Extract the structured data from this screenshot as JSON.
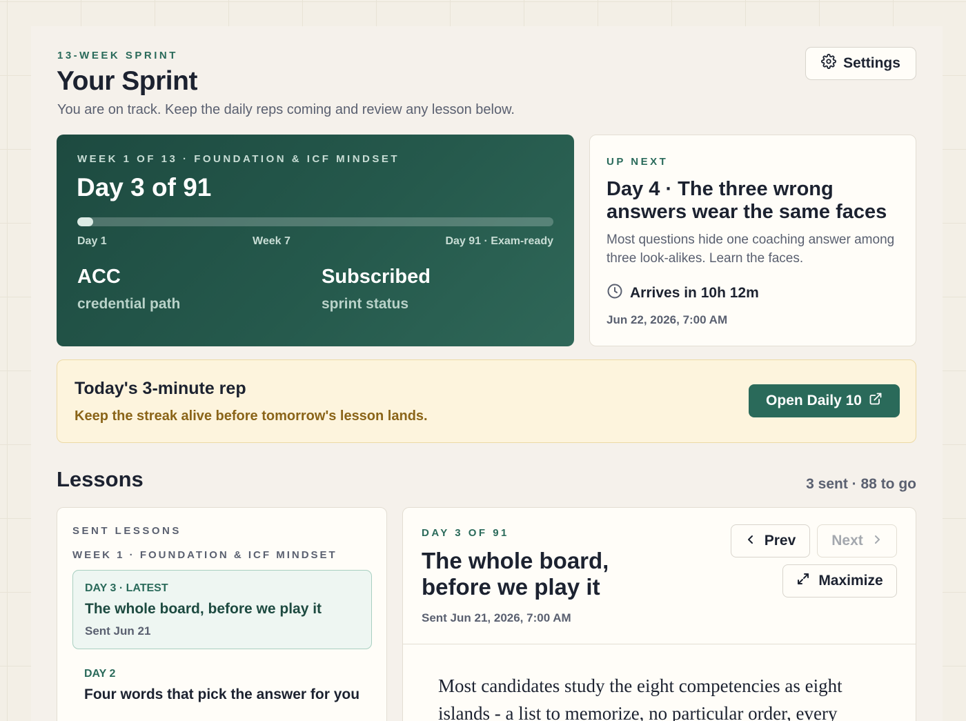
{
  "header": {
    "eyebrow": "13-WEEK SPRINT",
    "title": "Your Sprint",
    "subtitle": "You are on track. Keep the daily reps coming and review any lesson below.",
    "settings_label": "Settings"
  },
  "hero": {
    "eyebrow": "WEEK 1 OF 13 · FOUNDATION & ICF MINDSET",
    "day_title": "Day 3 of 91",
    "progress": 0.033,
    "milestones": [
      "Day 1",
      "Week 7",
      "Day 91 · Exam-ready"
    ],
    "stats": [
      {
        "value": "ACC",
        "label": "credential path"
      },
      {
        "value": "Subscribed",
        "label": "sprint status"
      }
    ]
  },
  "up_next": {
    "eyebrow": "UP NEXT",
    "title": "Day 4 · The three wrong answers wear the same faces",
    "description": "Most questions hide one coaching answer among three look-alikes. Learn the faces.",
    "arrives": "Arrives in 10h 12m",
    "date": "Jun 22, 2026, 7:00 AM"
  },
  "daily_rep": {
    "title": "Today's 3-minute rep",
    "subtitle": "Keep the streak alive before tomorrow's lesson lands.",
    "button_label": "Open Daily 10"
  },
  "lessons": {
    "title": "Lessons",
    "count": "3 sent · 88 to go",
    "list_eyebrow": "SENT LESSONS",
    "week_label": "WEEK 1 · FOUNDATION & ICF MINDSET",
    "items": [
      {
        "day": "DAY 3 · LATEST",
        "title": "The whole board, before we play it",
        "sent": "Sent Jun 21"
      },
      {
        "day": "DAY 2",
        "title": "Four words that pick the answer for you",
        "sent": ""
      }
    ]
  },
  "reader": {
    "eyebrow": "DAY 3 OF 91",
    "title": "The whole board, before we play it",
    "sent": "Sent Jun 21, 2026, 7:00 AM",
    "prev_label": "Prev",
    "next_label": "Next",
    "maximize_label": "Maximize",
    "body": "Most candidates study the eight competencies as eight islands - a list to memorize, no particular order, every"
  },
  "colors": {
    "accent": "#2a6a5a",
    "hero_bg": "#1d4a40",
    "banner_bg": "#fdf4dd",
    "banner_text": "#8a6418"
  }
}
